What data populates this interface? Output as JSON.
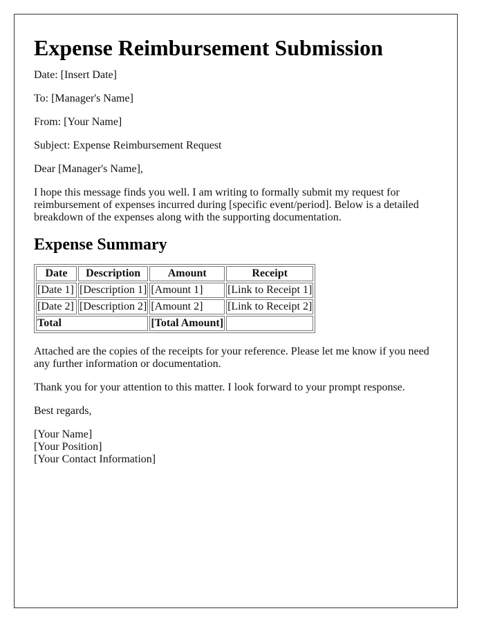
{
  "document": {
    "title": "Expense Reimbursement Submission",
    "date_line": "Date: [Insert Date]",
    "to_line": "To: [Manager's Name]",
    "from_line": "From: [Your Name]",
    "subject_line": "Subject: Expense Reimbursement Request",
    "salutation": "Dear [Manager's Name],",
    "intro_paragraph": "I hope this message finds you well. I am writing to formally submit my request for reimbursement of expenses incurred during [specific event/period]. Below is a detailed breakdown of the expenses along with the supporting documentation.",
    "summary_heading": "Expense Summary",
    "table": {
      "headers": [
        "Date",
        "Description",
        "Amount",
        "Receipt"
      ],
      "rows": [
        {
          "date": "[Date 1]",
          "description": "[Description 1]",
          "amount": "[Amount 1]",
          "receipt": "[Link to Receipt 1]"
        },
        {
          "date": "[Date 2]",
          "description": "[Description 2]",
          "amount": "[Amount 2]",
          "receipt": "[Link to Receipt 2]"
        }
      ],
      "total": {
        "label": "Total",
        "amount": "[Total Amount]",
        "receipt": ""
      }
    },
    "attachment_paragraph": "Attached are the copies of the receipts for your reference. Please let me know if you need any further information or documentation.",
    "thanks_paragraph": "Thank you for your attention to this matter. I look forward to your prompt response.",
    "closing": "Best regards,",
    "signature": {
      "name": "[Your Name]",
      "position": "[Your Position]",
      "contact": "[Your Contact Information]"
    }
  }
}
